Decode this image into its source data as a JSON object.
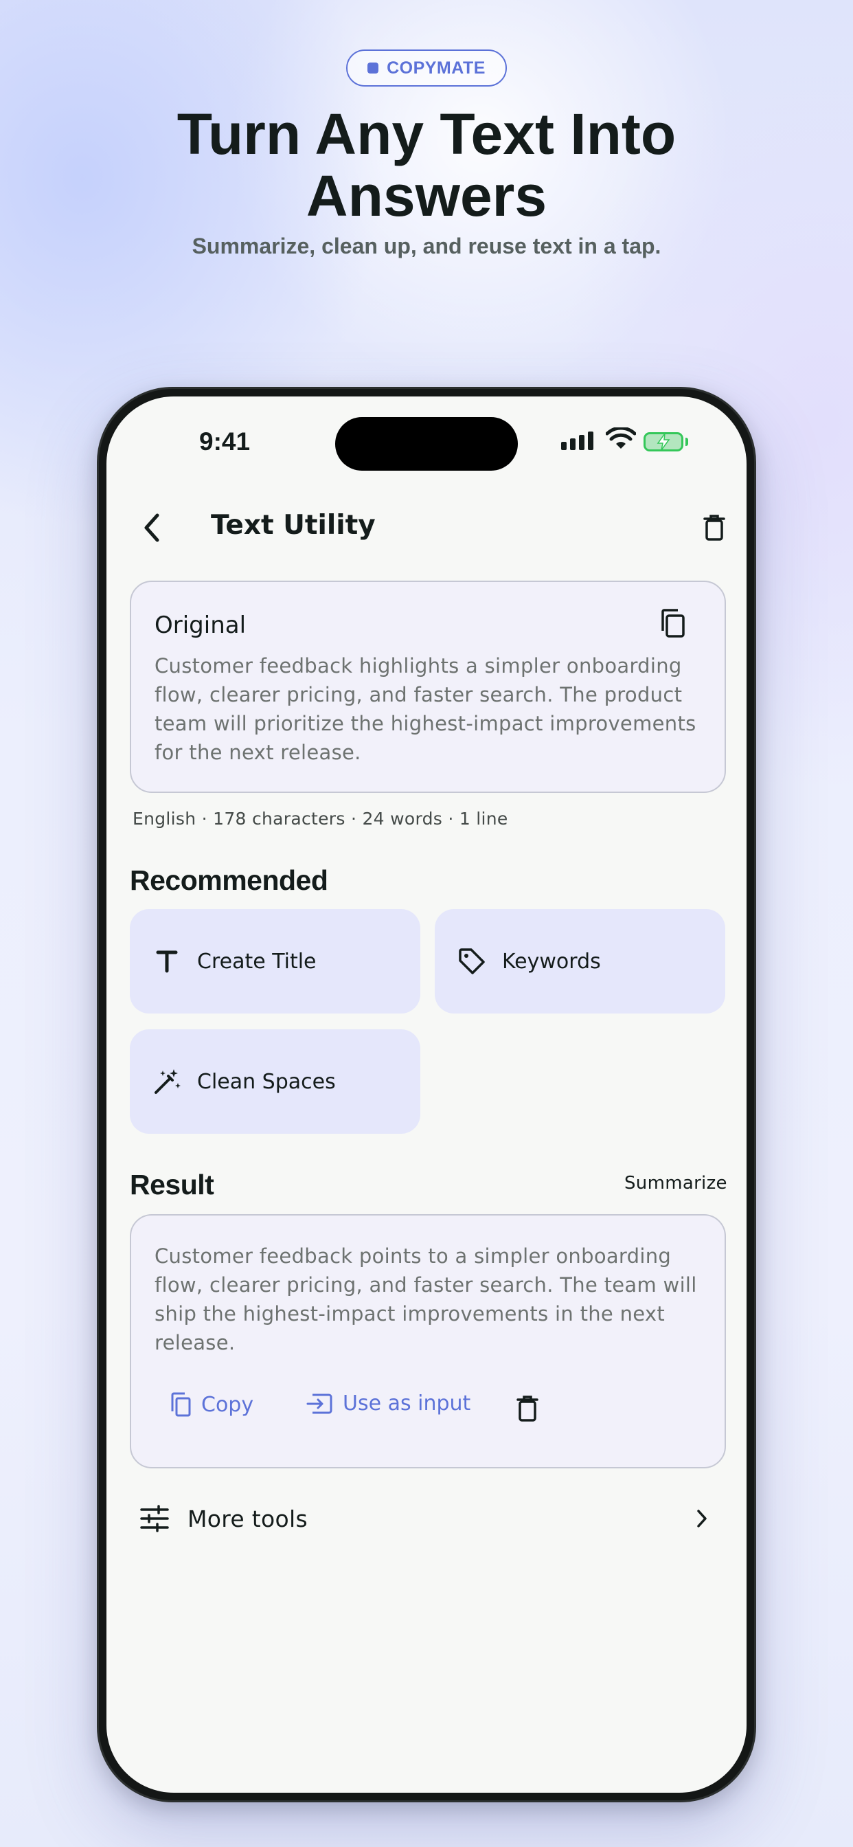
{
  "hero": {
    "badge": "COPYMATE",
    "headline_line1": "Turn Any Text Into",
    "headline_line2": "Answers",
    "subheadline": "Summarize, clean up, and reuse text in a tap."
  },
  "status_bar": {
    "time": "9:41"
  },
  "nav": {
    "title": "Text Utility"
  },
  "original": {
    "label": "Original",
    "text": "Customer feedback highlights a simpler onboarding flow, clearer pricing, and faster search. The product team will prioritize the highest-impact improvements for the next release.",
    "meta": "English · 178 characters · 24 words · 1 line"
  },
  "recommended": {
    "title": "Recommended",
    "items": [
      {
        "label": "Create Title",
        "icon": "title-icon"
      },
      {
        "label": "Keywords",
        "icon": "tag-icon"
      },
      {
        "label": "Clean Spaces",
        "icon": "magic-wand-icon"
      }
    ]
  },
  "result": {
    "title": "Result",
    "mode": "Summarize",
    "text": "Customer feedback points to a simpler onboarding flow, clearer pricing, and faster search. The team will ship the highest-impact improvements in the next release.",
    "actions": {
      "copy": "Copy",
      "use_as_input": "Use as input"
    }
  },
  "more_tools": {
    "label": "More tools"
  },
  "colors": {
    "accent": "#5c72d8",
    "chip_bg": "#e5e7fb",
    "card_bg": "#f2f1fa",
    "battery": "#34c759"
  }
}
